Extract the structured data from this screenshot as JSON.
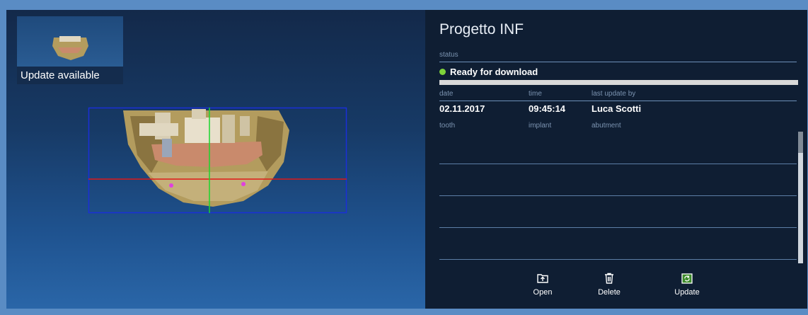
{
  "thumbnail": {
    "label": "Update available"
  },
  "project": {
    "title": "Progetto INF",
    "status_label": "status",
    "status_value": "Ready for download",
    "status_color": "#7fd33a",
    "progress": 1.0,
    "columns": {
      "date": "date",
      "time": "time",
      "last_update_by": "last update by"
    },
    "values": {
      "date": "02.11.2017",
      "time": "09:45:14",
      "last_update_by": "Luca Scotti"
    },
    "table_headers": [
      "tooth",
      "implant",
      "abutment"
    ]
  },
  "actions": {
    "open": "Open",
    "delete": "Delete",
    "update": "Update"
  },
  "icons": {
    "open": "folder-open-icon",
    "delete": "trash-icon",
    "update": "folder-refresh-icon"
  }
}
